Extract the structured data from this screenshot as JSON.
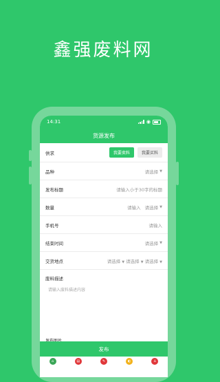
{
  "hero": {
    "title": "鑫强废料网"
  },
  "status": {
    "time": "14:31"
  },
  "nav": {
    "title": "货源发布"
  },
  "form": {
    "supply": {
      "label": "供求",
      "opt_sell": "我要卖料",
      "opt_buy": "我要买料"
    },
    "variety": {
      "label": "品种",
      "value": "请选择"
    },
    "title_row": {
      "label": "发布标题",
      "placeholder": "请输入小于30字的标题"
    },
    "quantity": {
      "label": "数量",
      "placeholder": "请输入",
      "unit": "请选择"
    },
    "phone": {
      "label": "手机号",
      "placeholder": "请输入"
    },
    "end_time": {
      "label": "结束时间",
      "value": "请选择"
    },
    "location": {
      "label": "交货地点",
      "province": "请选择",
      "city": "请选择",
      "district": "请选择"
    },
    "description": {
      "label": "废料描述",
      "placeholder": "请输入废料描述内容"
    },
    "photos": {
      "label": "发布图片"
    },
    "submit_label": "发布"
  },
  "tabbar": {
    "icons": [
      {
        "name": "home-icon",
        "color": "#3aa657"
      },
      {
        "name": "market-icon",
        "color": "#e0373a"
      },
      {
        "name": "publish-icon",
        "color": "#e0373a"
      },
      {
        "name": "news-icon",
        "color": "#f2b21c"
      },
      {
        "name": "profile-icon",
        "color": "#e0373a"
      }
    ]
  }
}
